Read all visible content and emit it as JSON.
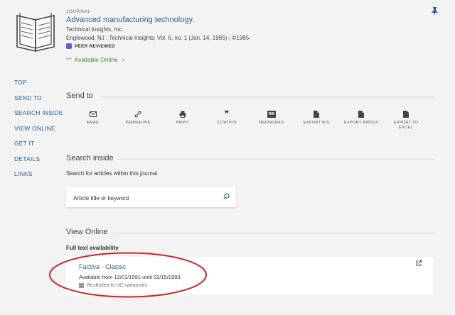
{
  "header": {
    "type_label": "JOURNAL",
    "title": "Advanced manufacturing technology.",
    "publisher": "Technical Insights, Inc.",
    "details": "Englewood, NJ : Technical Insights; Vol. 6, no. 1 (Jan. 14, 1985)-; ©1985-",
    "peer_reviewed": "PEER REVIEWED",
    "availability": "Available Online"
  },
  "sidenav": [
    "TOP",
    "SEND TO",
    "SEARCH INSIDE",
    "VIEW ONLINE",
    "GET IT",
    "DETAILS",
    "LINKS"
  ],
  "send_to": {
    "title": "Send to",
    "actions": [
      {
        "label": "EMAIL",
        "icon": "email-icon"
      },
      {
        "label": "PERMALINK",
        "icon": "link-icon"
      },
      {
        "label": "PRINT",
        "icon": "print-icon"
      },
      {
        "label": "CITATION",
        "icon": "quote-icon"
      },
      {
        "label": "REFWORKS",
        "icon": "refworks-icon",
        "icon_text": "RW"
      },
      {
        "label": "EXPORT RIS",
        "icon": "file-icon"
      },
      {
        "label": "EXPORT BIBTEX",
        "icon": "file-icon"
      },
      {
        "label": "EXPORT TO EXCEL",
        "icon": "excel-file-icon",
        "icon_text": "X"
      }
    ]
  },
  "search_inside": {
    "title": "Search inside",
    "subtitle": "Search for articles within this journal",
    "placeholder": "Article title or keyword"
  },
  "view_online": {
    "title": "View Online",
    "full_text_label": "Full text availability",
    "provider": "Factiva - Classic",
    "range": "Available from 12/01/1991 until 02/15/1993.",
    "restriction": "Restricted to UC campuses"
  },
  "colors": {
    "link": "#2a5f8a",
    "available": "#3b8a3b",
    "peer_badge": "#7b52c8",
    "annotation": "#d0262c"
  }
}
